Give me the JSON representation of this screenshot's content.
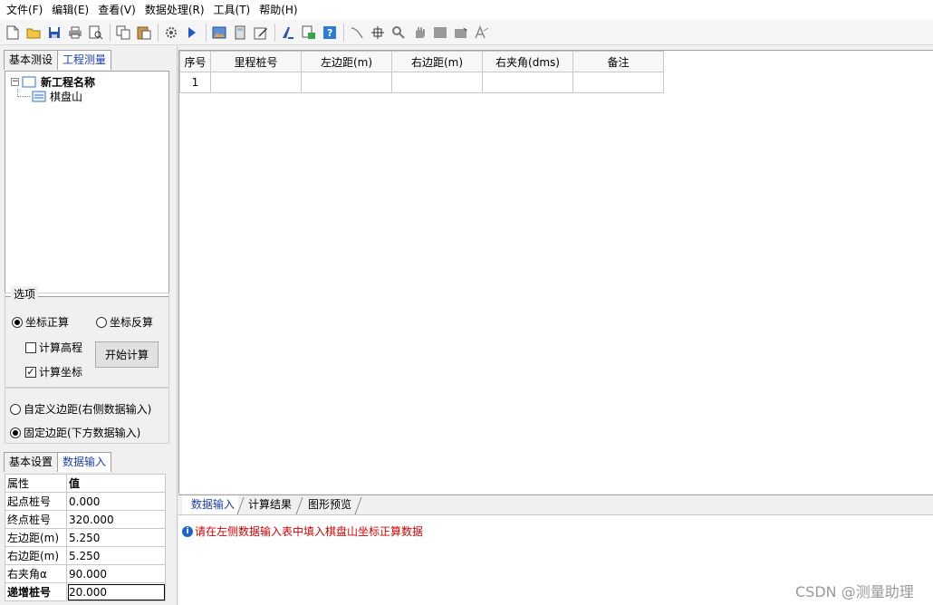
{
  "menu": [
    "文件(F)",
    "编辑(E)",
    "查看(V)",
    "数据处理(R)",
    "工具(T)",
    "帮助(H)"
  ],
  "toolbar_icons": [
    "new-icon",
    "open-icon",
    "save-icon",
    "print-icon",
    "print-preview-icon",
    "copy-icon",
    "paste-icon",
    "settings-icon",
    "run-icon",
    "image-icon",
    "calculator-icon",
    "edit-icon",
    "font-icon",
    "export-icon",
    "help-icon",
    "line-icon",
    "crosshair-icon",
    "zoom-icon",
    "pan-icon",
    "rectangle-icon",
    "screenshot-icon",
    "text-icon"
  ],
  "left_tabs": {
    "basic": "基本测设",
    "project": "工程测量"
  },
  "tree": {
    "root": "新工程名称",
    "child": "棋盘山"
  },
  "options": {
    "legend": "选项",
    "forward": "坐标正算",
    "inverse": "坐标反算",
    "calc_elevation": "计算高程",
    "calc_coords": "计算坐标",
    "start_button": "开始计算",
    "custom_offset": "自定义边距(右侧数据输入)",
    "fixed_offset": "固定边距(下方数据输入)"
  },
  "prop_tabs": {
    "basic_settings": "基本设置",
    "data_input": "数据输入"
  },
  "properties": {
    "header": {
      "key": "属性",
      "value": "值"
    },
    "rows": [
      {
        "key": "起点桩号",
        "value": "0.000"
      },
      {
        "key": "终点桩号",
        "value": "320.000"
      },
      {
        "key": "左边距(m)",
        "value": "5.250"
      },
      {
        "key": "右边距(m)",
        "value": "5.250"
      },
      {
        "key": "右夹角α",
        "value": "90.000"
      },
      {
        "key": "递增桩号",
        "value": "20.000"
      }
    ]
  },
  "grid": {
    "headers": [
      "序号",
      "里程桩号",
      "左边距(m)",
      "右边距(m)",
      "右夹角(dms)",
      "备注"
    ],
    "rows": [
      [
        "1",
        "",
        "",
        "",
        "",
        ""
      ]
    ]
  },
  "bottom_tabs": [
    "数据输入",
    "计算结果",
    "图形预览"
  ],
  "message": "请在左侧数据输入表中填入棋盘山坐标正算数据",
  "watermark": "CSDN @测量助理"
}
